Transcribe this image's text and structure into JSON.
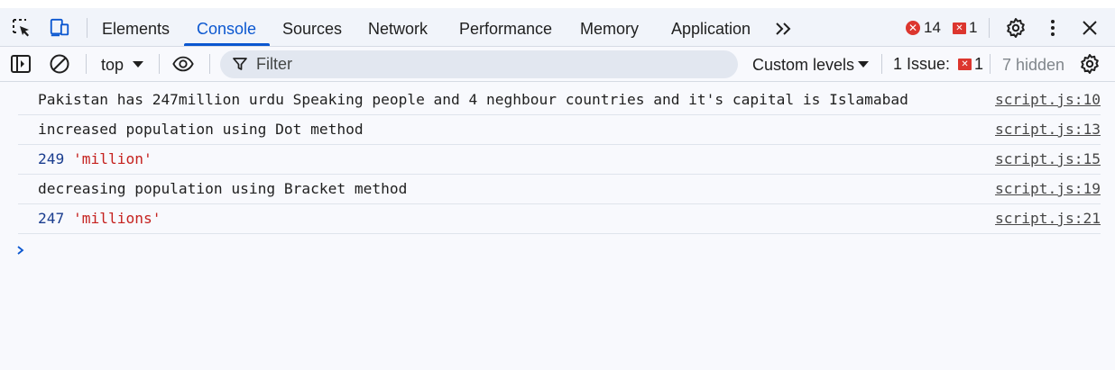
{
  "tabs": [
    {
      "label": "Elements",
      "active": false
    },
    {
      "label": "Console",
      "active": true
    },
    {
      "label": "Sources",
      "active": false
    },
    {
      "label": "Network",
      "active": false
    },
    {
      "label": "Performance",
      "active": false
    },
    {
      "label": "Memory",
      "active": false
    },
    {
      "label": "Application",
      "active": false
    }
  ],
  "counts": {
    "errors": "14",
    "issues": "1",
    "error_color": "#dc362e"
  },
  "toolbar": {
    "context": "top",
    "filter_placeholder": "Filter",
    "levels": "Custom levels",
    "issue_label": "1 Issue:",
    "issue_count": "1",
    "hidden": "7 hidden"
  },
  "messages": [
    {
      "parts": [
        {
          "text": "Pakistan has 247million urdu Speaking people and 4 neghbour countries and it's capital is Islamabad",
          "kind": "text"
        }
      ],
      "source": "script.js:10"
    },
    {
      "parts": [
        {
          "text": "increased population using Dot method",
          "kind": "text"
        }
      ],
      "source": "script.js:13"
    },
    {
      "parts": [
        {
          "text": "249",
          "kind": "num"
        },
        {
          "text": " ",
          "kind": "text"
        },
        {
          "text": "'million'",
          "kind": "str"
        }
      ],
      "source": "script.js:15"
    },
    {
      "parts": [
        {
          "text": "decreasing population using Bracket method",
          "kind": "text"
        }
      ],
      "source": "script.js:19"
    },
    {
      "parts": [
        {
          "text": "247",
          "kind": "num"
        },
        {
          "text": " ",
          "kind": "text"
        },
        {
          "text": "'millions'",
          "kind": "str"
        }
      ],
      "source": "script.js:21"
    }
  ],
  "icons": {
    "inspect": "inspect-element-icon",
    "device": "device-toolbar-icon",
    "more_tabs": "more-tabs-icon",
    "settings": "gear-icon",
    "menu": "kebab-menu-icon",
    "close": "close-icon",
    "sidebar": "sidebar-toggle-icon",
    "clear": "clear-console-icon",
    "eye": "live-expression-icon",
    "filter": "filter-icon",
    "prompt": "chevron-right-icon"
  },
  "colors": {
    "accent": "#0b57d0",
    "string": "#c5221f",
    "number": "#1a3d8f"
  }
}
